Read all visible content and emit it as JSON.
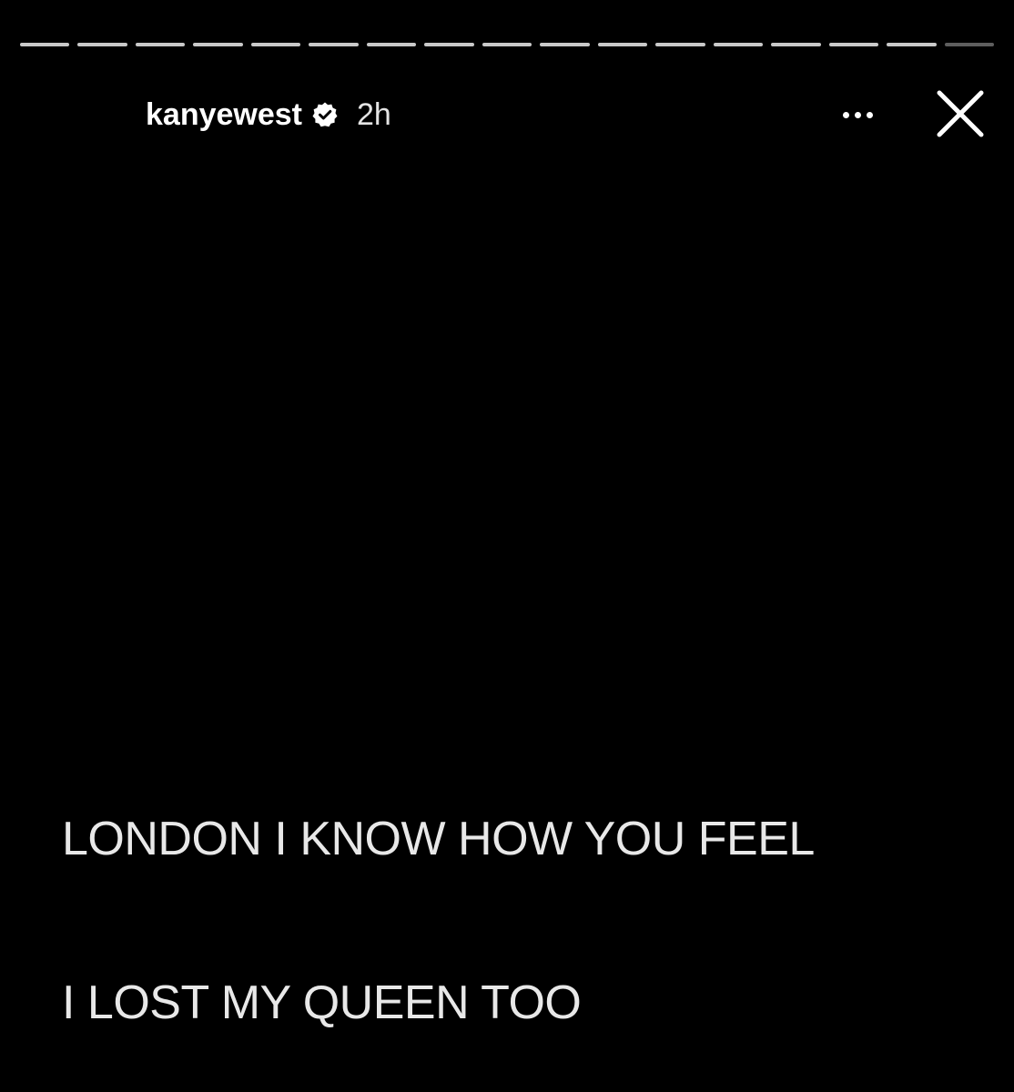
{
  "progress": {
    "segments": 17,
    "bar_color": "#c9c9c9",
    "current_color": "#5e5e5e"
  },
  "header": {
    "username": "kanyewest",
    "verified_icon": "verified-badge-icon",
    "time_ago": "2h"
  },
  "controls": {
    "more_icon": "more-options-icon",
    "close_icon": "close-icon"
  },
  "story": {
    "lines": [
      "LONDON I KNOW HOW YOU FEEL",
      "I LOST MY QUEEN TOO"
    ]
  },
  "colors": {
    "background": "#000000",
    "text": "#e8e8e8"
  }
}
